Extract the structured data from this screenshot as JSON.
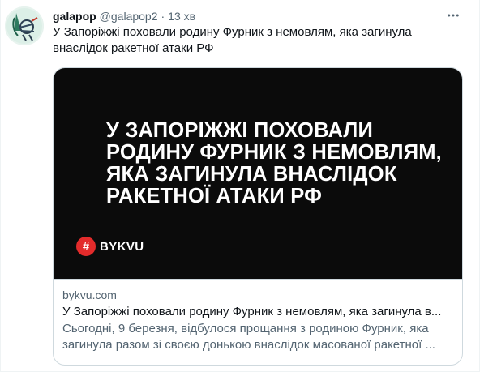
{
  "tweet": {
    "author_name": "galapop",
    "author_handle": "@galapop2",
    "separator": "·",
    "time": "13 хв",
    "text": "У Запоріжжі поховали родину Фурник з немовлям, яка загинула внаслідок ракетної атаки РФ",
    "more_icon": "more-horizontal-icon"
  },
  "card": {
    "image": {
      "headline": "У ЗАПОРІЖЖІ ПОХОВАЛИ РОДИНУ ФУРНИК З НЕМОВЛЯМ, ЯКА ЗАГИНУЛА ВНАСЛІДОК РАКЕТНОЇ АТАКИ РФ",
      "brand_symbol": "#",
      "brand_name": "BYKVU",
      "background": "#0b0b0b",
      "brand_color": "#e32b2b"
    },
    "domain": "bykvu.com",
    "title": "У Запоріжжі поховали родину Фурник з немовлям, яка загинула в...",
    "description": "Сьогодні, 9 березня, відбулося прощання з родиною Фурник, яка загинула разом зі своєю донькою внаслідок масованої ракетної ..."
  },
  "colors": {
    "text_primary": "#0f1419",
    "text_secondary": "#536471",
    "border": "#cfd9de"
  }
}
